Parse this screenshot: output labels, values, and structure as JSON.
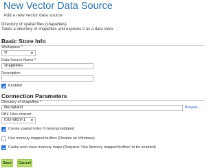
{
  "header": {
    "title": "New Vector Data Source",
    "subtitle": "Add a new vector data source"
  },
  "source": {
    "type": "Directory of spatial files (shapefiles)",
    "description": "Takes a directory of shapefiles and exposes it as a data store"
  },
  "basic_info": {
    "heading": "Basic Store Info",
    "workspace_label": "Workspace *",
    "workspace_value": "sf",
    "name_label": "Data Source Name *",
    "name_value": "shapefiles",
    "description_label": "Description",
    "description_value": "",
    "enabled_label": "Enabled",
    "enabled_checked": true
  },
  "connection": {
    "heading": "Connection Parameters",
    "directory_label": "Directory of shapefiles *",
    "directory_value": "file:data/sf",
    "browse_label": "Browse...",
    "charset_label": "DBF Files charset",
    "charset_value": "ISO-8859-1",
    "options": [
      {
        "label": "Create spatial index if missing/outdated",
        "checked": true
      },
      {
        "label": "Use memory mapped buffers (Disable on Windows)",
        "checked": false
      },
      {
        "label": "Cache and reuse memory maps (Requires 'Use Memory mapped buffers' to be enabled)",
        "checked": true
      }
    ]
  },
  "actions": {
    "save_label": "Save",
    "cancel_label": "Cancel"
  },
  "colors": {
    "title": "#2d6fa2",
    "checkbox": "#2a71d0",
    "button": "#b9dc71",
    "link": "#1f5fb5"
  },
  "icons": {
    "select_arrow": "chevron-down-icon",
    "checkmark": "check-icon"
  }
}
